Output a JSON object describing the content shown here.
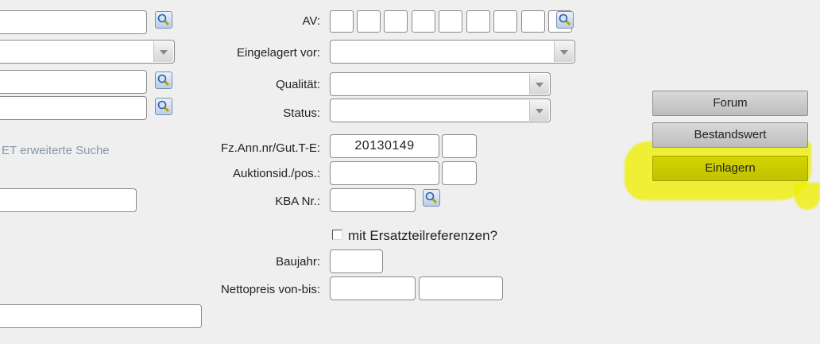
{
  "colors": {
    "background": "#efefef",
    "highlight": "#eeee00",
    "link": "#8a97a8"
  },
  "left": {
    "extended_search_link": "ET erweiterte Suche"
  },
  "form": {
    "av": {
      "label": "AV:",
      "box_count": 9
    },
    "eingelagert_vor": {
      "label": "Eingelagert vor:",
      "value": ""
    },
    "qualitaet": {
      "label": "Qualität:",
      "value": ""
    },
    "status": {
      "label": "Status:",
      "value": ""
    },
    "fz_ann_nr": {
      "label": "Fz.Ann.nr/Gut.T-E:",
      "value": "20130149",
      "suffix": ""
    },
    "auktionsid": {
      "label": "Auktionsid./pos.:",
      "value": "",
      "pos": ""
    },
    "kba_nr": {
      "label": "KBA Nr.:",
      "value": ""
    },
    "ersatzteil": {
      "label": "mit Ersatzteilreferenzen?",
      "checked": false
    },
    "baujahr": {
      "label": "Baujahr:",
      "value": ""
    },
    "nettopreis": {
      "label": "Nettopreis von-bis:",
      "from": "",
      "to": ""
    }
  },
  "buttons": {
    "forum": "Forum",
    "bestandswert": "Bestandswert",
    "einlagern": "Einlagern"
  }
}
